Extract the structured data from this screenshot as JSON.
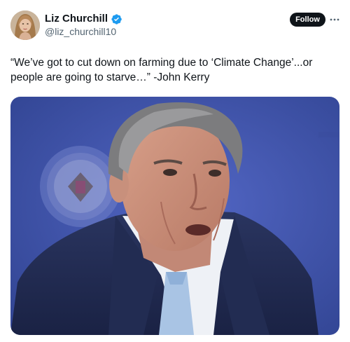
{
  "author": {
    "display_name": "Liz Churchill",
    "handle": "@liz_churchill10",
    "verified": true,
    "avatar_icon": "profile-photo"
  },
  "actions": {
    "follow_label": "Follow",
    "more_icon": "more-horizontal-icon"
  },
  "tweet": {
    "text": "“We’ve got to cut down on farming due to ‘Climate Change’...or people are going to starve…” -John Kerry"
  },
  "media": {
    "type": "photo",
    "description_icon": "tweet-photo"
  },
  "colors": {
    "text_primary": "#0f1419",
    "text_secondary": "#536471",
    "verified_blue": "#1d9bf0",
    "follow_bg": "#0f1419",
    "photo_background": "#3f57b0"
  }
}
